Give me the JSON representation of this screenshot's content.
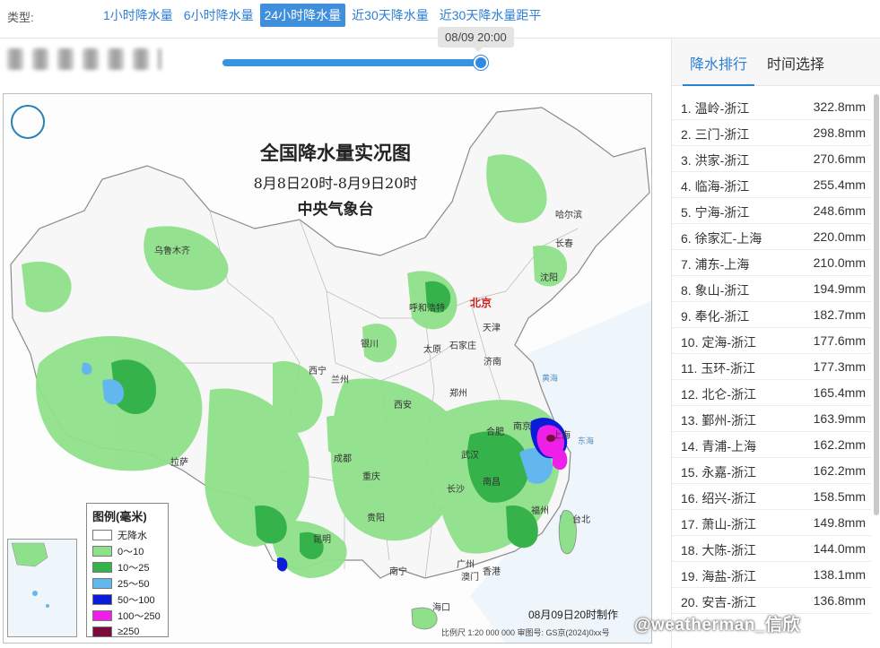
{
  "header": {
    "type_label": "类型:",
    "tabs": [
      {
        "label": "1小时降水量",
        "active": false
      },
      {
        "label": "6小时降水量",
        "active": false
      },
      {
        "label": "24小时降水量",
        "active": true
      },
      {
        "label": "近30天降水量",
        "active": false
      },
      {
        "label": "近30天降水量距平",
        "active": false
      }
    ]
  },
  "slider": {
    "tooltip": "08/09 20:00",
    "progress_fraction": 1.0
  },
  "map": {
    "title": "全国降水量实况图",
    "subtitle": "8月8日20时-8月9日20时",
    "agency": "中央气象台",
    "footer": "08月09日20时制作",
    "scale": "比例尺 1:20 000 000  审图号: GS京(2024)0хх号",
    "legend": {
      "title": "图例(毫米)",
      "items": [
        {
          "label": "无降水",
          "color": "#ffffff"
        },
        {
          "label": "0～10",
          "color": "#8fe08a"
        },
        {
          "label": "10～25",
          "color": "#35b24a"
        },
        {
          "label": "25～50",
          "color": "#62b8ee"
        },
        {
          "label": "50～100",
          "color": "#0a1cd8"
        },
        {
          "label": "100～250",
          "color": "#ee1fe6"
        },
        {
          "label": "≥250",
          "color": "#7a0c3c"
        }
      ]
    },
    "cities": [
      {
        "name": "北京",
        "capital": true
      },
      {
        "name": "哈尔滨"
      },
      {
        "name": "长春"
      },
      {
        "name": "沈阳"
      },
      {
        "name": "乌鲁木齐"
      },
      {
        "name": "呼和浩特"
      },
      {
        "name": "天津"
      },
      {
        "name": "银川"
      },
      {
        "name": "太原"
      },
      {
        "name": "石家庄"
      },
      {
        "name": "济南"
      },
      {
        "name": "西宁"
      },
      {
        "name": "兰州"
      },
      {
        "name": "郑州"
      },
      {
        "name": "西安"
      },
      {
        "name": "南京"
      },
      {
        "name": "合肥"
      },
      {
        "name": "上海"
      },
      {
        "name": "武汉"
      },
      {
        "name": "拉萨"
      },
      {
        "name": "成都"
      },
      {
        "name": "重庆"
      },
      {
        "name": "长沙"
      },
      {
        "name": "南昌"
      },
      {
        "name": "福州"
      },
      {
        "name": "贵阳"
      },
      {
        "name": "昆明"
      },
      {
        "name": "南宁"
      },
      {
        "name": "广州"
      },
      {
        "name": "香港"
      },
      {
        "name": "澳门"
      },
      {
        "name": "海口"
      },
      {
        "name": "台北"
      }
    ],
    "seas": [
      "黄海",
      "东海"
    ],
    "colors": {
      "land": "#f7f7f7",
      "border": "#9a9a9a",
      "sea": "#e9f3fb"
    }
  },
  "watermark": "@weatherman_信欣",
  "panel": {
    "tabs": [
      {
        "label": "降水排行",
        "active": true
      },
      {
        "label": "时间选择",
        "active": false
      }
    ],
    "ranking": [
      {
        "name": "1. 温岭-浙江",
        "value": "322.8mm"
      },
      {
        "name": "2. 三门-浙江",
        "value": "298.8mm"
      },
      {
        "name": "3. 洪家-浙江",
        "value": "270.6mm"
      },
      {
        "name": "4. 临海-浙江",
        "value": "255.4mm"
      },
      {
        "name": "5. 宁海-浙江",
        "value": "248.6mm"
      },
      {
        "name": "6. 徐家汇-上海",
        "value": "220.0mm"
      },
      {
        "name": "7. 浦东-上海",
        "value": "210.0mm"
      },
      {
        "name": "8. 象山-浙江",
        "value": "194.9mm"
      },
      {
        "name": "9. 奉化-浙江",
        "value": "182.7mm"
      },
      {
        "name": "10. 定海-浙江",
        "value": "177.6mm"
      },
      {
        "name": "11. 玉环-浙江",
        "value": "177.3mm"
      },
      {
        "name": "12. 北仑-浙江",
        "value": "165.4mm"
      },
      {
        "name": "13. 鄞州-浙江",
        "value": "163.9mm"
      },
      {
        "name": "14. 青浦-上海",
        "value": "162.2mm"
      },
      {
        "name": "15. 永嘉-浙江",
        "value": "162.2mm"
      },
      {
        "name": "16. 绍兴-浙江",
        "value": "158.5mm"
      },
      {
        "name": "17. 萧山-浙江",
        "value": "149.8mm"
      },
      {
        "name": "18. 大陈-浙江",
        "value": "144.0mm"
      },
      {
        "name": "19. 海盐-浙江",
        "value": "138.1mm"
      },
      {
        "name": "20. 安吉-浙江",
        "value": "136.8mm"
      }
    ],
    "accent": "#2c7fd4"
  }
}
